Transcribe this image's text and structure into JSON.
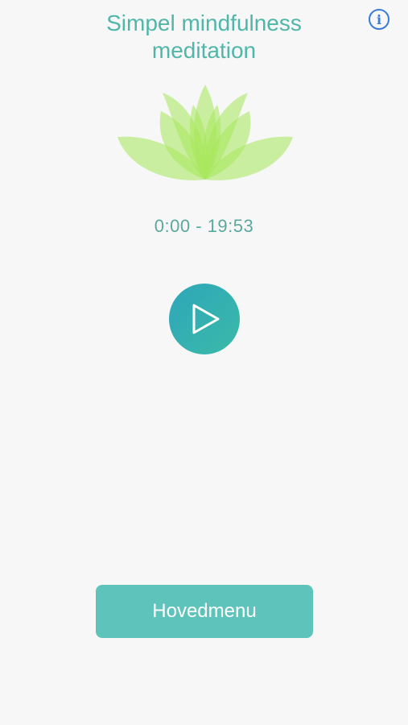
{
  "header": {
    "title_line1": "Simpel mindfulness",
    "title_line2": "meditation",
    "info_icon": "info-icon"
  },
  "player": {
    "time_display": "0:00 - 19:53",
    "play_icon": "play-icon"
  },
  "footer": {
    "main_menu_label": "Hovedmenu"
  },
  "colors": {
    "title": "#4fb6a9",
    "accent_teal": "#3bbaa9",
    "info_blue": "#3a7ad8",
    "leaf_green": "#c8f07a",
    "button_bg": "#5ec4bb",
    "background": "#f7f7f7"
  }
}
